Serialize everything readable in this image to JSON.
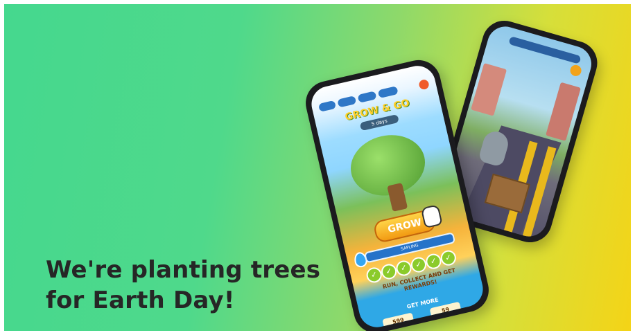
{
  "headline": {
    "line1": "We're planting trees",
    "line2": "for Earth Day!"
  },
  "front_phone": {
    "title": "GROW & GO",
    "timer": "5 days",
    "button": "GROW",
    "progress_label": "SAPLING",
    "reward_text": "RUN, COLLECT AND GET REWARDS!",
    "get_more": "GET MORE",
    "costs": [
      "599",
      "59"
    ]
  },
  "colors": {
    "gradient_start": "#45d88e",
    "gradient_end": "#f4d417",
    "headline_text": "#262626"
  }
}
